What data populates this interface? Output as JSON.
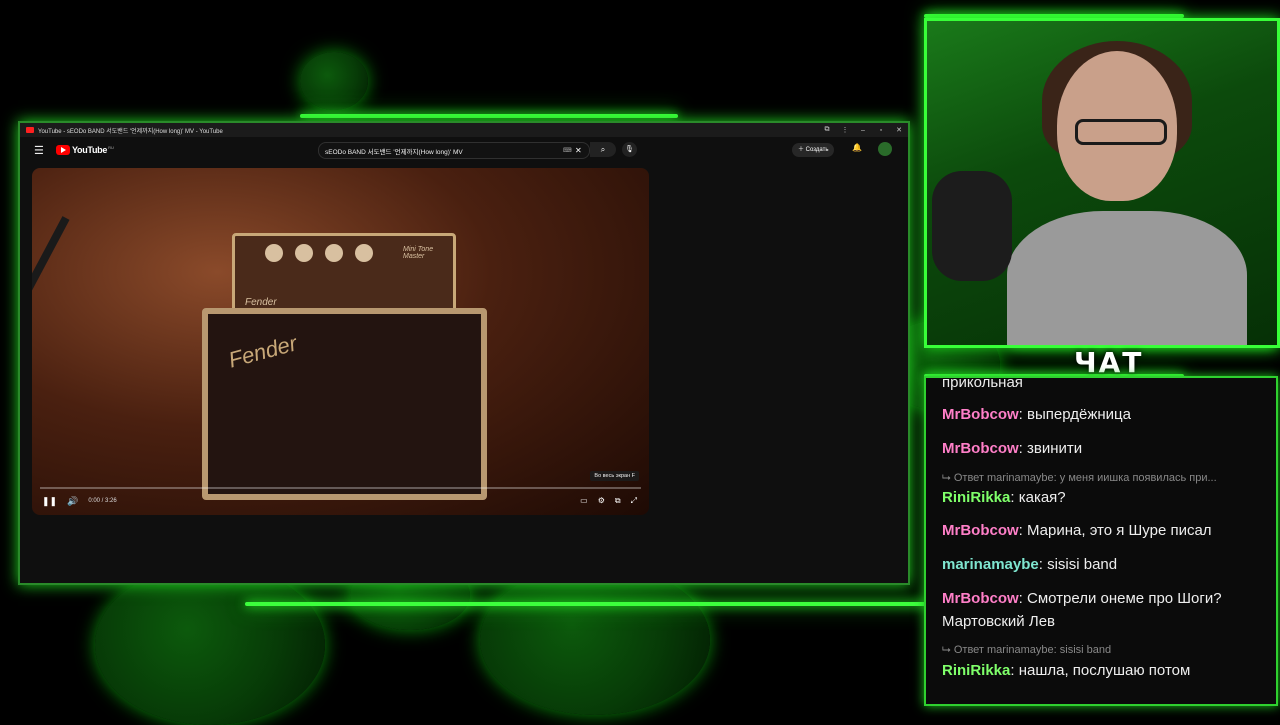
{
  "browser": {
    "title": "YouTube - sEODo BAND 서도밴드 '언제까지(How long)' MV - YouTube",
    "controls": [
      "⧉",
      "⋮",
      "–",
      "▫",
      "✕"
    ]
  },
  "youtube": {
    "logo_text": "YouTube",
    "region": "RU",
    "search_query": "sEODo BAND 서도밴드 '언제까지(How long)' MV",
    "create_label": "Создать",
    "player": {
      "time": "0:00 / 3:26",
      "fullscreen_tooltip": "Во весь экран  F",
      "progress_fraction": 0.0,
      "amp_brand": "Fender",
      "amp_model": "Mini Tone Master"
    }
  },
  "overlay": {
    "chat_title": "ЧАТ",
    "accent_color": "#38ff38"
  },
  "chat": {
    "cut_top": "прикольная",
    "messages": [
      {
        "user": "MrBobcow",
        "color": "#ff7fc8",
        "text": "выпердёжница"
      },
      {
        "user": "MrBobcow",
        "color": "#ff7fc8",
        "text": "звинити"
      },
      {
        "reply": "Ответ marinamaybe: у меня иишка появилась при..."
      },
      {
        "user": "RiniRikka",
        "color": "#7fff6a",
        "text": "какая?"
      },
      {
        "user": "MrBobcow",
        "color": "#ff7fc8",
        "text": "Марина, это я Шуре писал"
      },
      {
        "user": "marinamaybe",
        "color": "#7fe6d0",
        "text": "sisisi band"
      },
      {
        "user": "MrBobcow",
        "color": "#ff7fc8",
        "text": "Смотрели онеме про Шоги?"
      },
      {
        "continuation": "Мартовский Лев"
      },
      {
        "reply": "Ответ marinamaybe: sisisi band"
      },
      {
        "user": "RiniRikka",
        "color": "#7fff6a",
        "text": "нашла, послушаю потом"
      }
    ]
  }
}
